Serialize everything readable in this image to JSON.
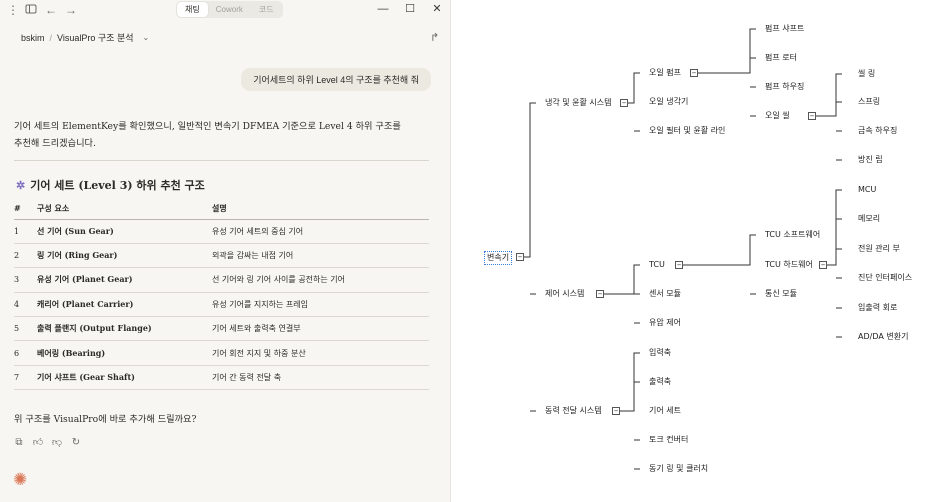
{
  "titlebar": {
    "tabs": [
      "채팅",
      "Cowork",
      "코드"
    ],
    "active_tab": "채팅",
    "icons": [
      "menu-icon",
      "sidebar-icon",
      "back-arrow-icon",
      "forward-arrow-icon"
    ],
    "window_controls": [
      "—",
      "☐",
      "✕"
    ]
  },
  "breadcrumb": {
    "user": "bskim",
    "separator": "/",
    "project": "VisualPro 구조 분석"
  },
  "user_message": "기어세트의 하위 Level 4의 구조를 추천해 줘",
  "assistant": {
    "intro_line1": "기어 세트의 ElementKey를 확인했으니, 일반적인 변속기 DFMEA 기준으로 Level 4 하위 구조를",
    "intro_line2": "추천해 드리겠습니다.",
    "heading": "기어 세트 (Level 3) 하위 추천 구조",
    "table": {
      "headers": [
        "#",
        "구성 요소",
        "설명"
      ],
      "rows": [
        [
          "1",
          "선 기어 (Sun Gear)",
          "유성 기어 세트의 중심 기어"
        ],
        [
          "2",
          "링 기어 (Ring Gear)",
          "외곽을 감싸는 내접 기어"
        ],
        [
          "3",
          "유성 기어 (Planet Gear)",
          "선 기어와 링 기어 사이를 공전하는 기어"
        ],
        [
          "4",
          "캐리어 (Planet Carrier)",
          "유성 기어를 지지하는 프레임"
        ],
        [
          "5",
          "출력 플랜지 (Output Flange)",
          "기어 세트와 출력축 연결부"
        ],
        [
          "6",
          "베어링 (Bearing)",
          "기어 회전 지지 및 하중 분산"
        ],
        [
          "7",
          "기어 샤프트 (Gear Shaft)",
          "기어 간 동력 전달 축"
        ]
      ]
    },
    "question": "위 구조를 VisualPro에 바로 추가해 드릴까요?"
  },
  "mindmap": {
    "root": "변속기",
    "n_l1_0": "냉각 및 윤활 시스템",
    "n_l1_1": "제어 시스템",
    "n_l1_2": "동력 전달 시스템",
    "n_oil_pump": "오일 펌프",
    "n_oil_cool": "오일 냉각기",
    "n_oil_filter": "오일 필터 및 윤활 라인",
    "n_pump_shaft": "펌프 샤프트",
    "n_pump_rotor": "펌프 로터",
    "n_pump_housing": "펌프 하우징",
    "n_oil_seal": "오일 씰",
    "n_seal_ring": "씰 링",
    "n_spring": "스프링",
    "n_metal_housing": "금속 하우징",
    "n_dust_lip": "방진 립",
    "n_tcu": "TCU",
    "n_sensor": "센서 모듈",
    "n_hyd": "유압 제어",
    "n_tcu_sw": "TCU 소프트웨어",
    "n_tcu_hw": "TCU 하드웨어",
    "n_comm": "통신 모듈",
    "n_mcu": "MCU",
    "n_mem": "메모리",
    "n_power": "전원 관리 부",
    "n_diag": "진단 인터페이스",
    "n_io": "입출력 회로",
    "n_adda": "AD/DA 변환기",
    "n_in_shaft": "입력축",
    "n_out_shaft": "출력축",
    "n_gearset": "기어 세트",
    "n_torque": "토크 컨버터",
    "n_clutch": "동기 링 및 클러치"
  }
}
